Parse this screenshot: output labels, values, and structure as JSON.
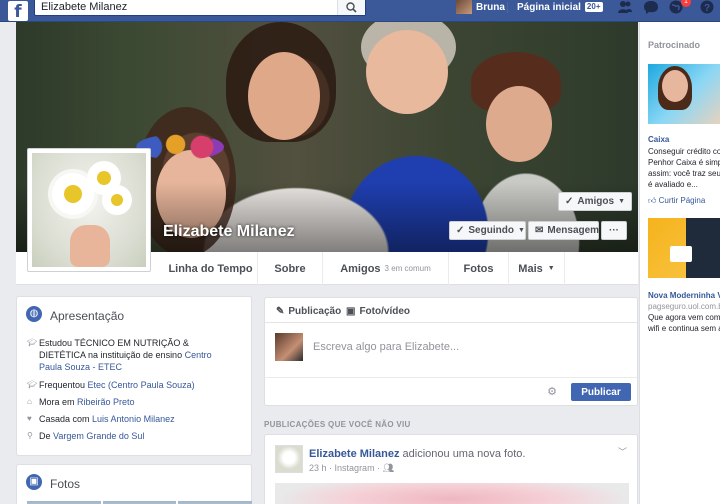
{
  "topbar": {
    "logo": "f",
    "search_value": "Elizabete Milanez",
    "user_name": "Bruna",
    "home_label": "Página inicial",
    "home_badge": "20+",
    "notif_count": "1"
  },
  "cover": {
    "name": "Elizabete Milanez",
    "friends_button": "Amigos",
    "following_button": "Seguindo",
    "message_button": "Mensagem",
    "more_button": "···"
  },
  "nav": {
    "tabs": [
      {
        "label": "Linha do Tempo"
      },
      {
        "label": "Sobre"
      },
      {
        "label": "Amigos",
        "sub": "3 em comum"
      },
      {
        "label": "Fotos"
      },
      {
        "label": "Mais"
      }
    ]
  },
  "intro": {
    "title": "Apresentação",
    "items": [
      {
        "text": "Estudou TÉCNICO EM NUTRIÇÃO & DIETÉTICA na instituição de ensino ",
        "link": "Centro Paula Souza - ETEC"
      },
      {
        "text": "Frequentou ",
        "link": "Etec (Centro Paula Souza)"
      },
      {
        "text": "Mora em ",
        "link": "Ribeirão Preto"
      },
      {
        "text": "Casada com ",
        "link": "Luis Antonio Milanez"
      },
      {
        "text": "De ",
        "link": "Vargem Grande do Sul"
      }
    ]
  },
  "fotos": {
    "title": "Fotos"
  },
  "composer": {
    "tab_post": "Publicação",
    "tab_photo": "Foto/vídeo",
    "placeholder": "Escreva algo para Elizabete...",
    "publish": "Publicar"
  },
  "feed": {
    "section_label": "PUBLICAÇÕES QUE VOCÊ NÃO VIU",
    "post": {
      "author": "Elizabete Milanez",
      "action": " adicionou uma nova foto.",
      "time": "23 h",
      "via": "Instagram"
    }
  },
  "sidebar": {
    "title": "Patrocinado",
    "ad1": {
      "brand": "Caixa",
      "line1": "Conseguir crédito co",
      "line2": "Penhor Caixa é simp",
      "line3": "assim: você traz seu",
      "line4": "é avaliado e...",
      "like": "Curtir Página"
    },
    "ad2": {
      "title": "Nova Moderninha V",
      "source": "pagseguro.uol.com.b",
      "line1": "Que agora vem com",
      "line2": "wifi e continua sem a"
    }
  },
  "colors": {
    "brand": "#3b5998",
    "button_blue": "#4267b2",
    "link": "#365899"
  }
}
